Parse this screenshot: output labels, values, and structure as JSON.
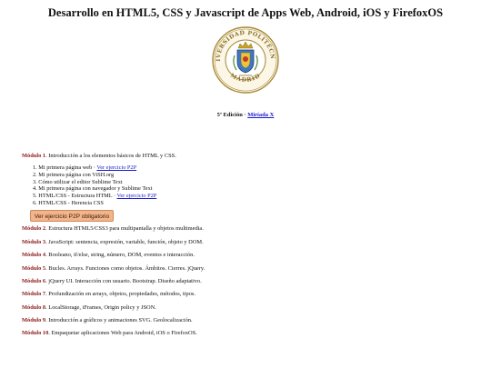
{
  "page": {
    "title": "Desarrollo en HTML5, CSS y Javascript de Apps Web, Android, iOS y FirefoxOS"
  },
  "seal": {
    "ring_text": "UNIVERSIDAD POLITÉCNICA MADRID",
    "color": "#a88b3a"
  },
  "edition": {
    "text": "5ª Edición · ",
    "link": "Miríada X"
  },
  "modules": [
    {
      "label": "Módulo 1",
      "text": ". Introducción a los elementos básicos de HTML y CSS."
    },
    {
      "label": "Módulo 2",
      "text": ". Estructura HTML5/CSS3 para multipantalla y objetos multimedia."
    },
    {
      "label": "Módulo 3",
      "text": ". JavaScript: sentencia, expresión, variable, función, objeto y DOM."
    },
    {
      "label": "Módulo 4",
      "text": ". Booleano, if/else, string, número, DOM, eventos e interacción."
    },
    {
      "label": "Módulo 5",
      "text": ". Bucles. Arrays. Funciones como objetos. Ámbitos. Cierres. jQuery."
    },
    {
      "label": "Módulo 6",
      "text": ". jQuery UI. Interacción con usuario. Bootstrap. Diseño adaptativo."
    },
    {
      "label": "Módulo 7",
      "text": ". Profundización en arrays, objetos, propiedades, métodos, tipos."
    },
    {
      "label": "Módulo 8",
      "text": ". LocalStorage, iFrames, Origin policy y JSON."
    },
    {
      "label": "Módulo 9",
      "text": ". Introducción a gráficos y animaciones SVG. Geolocalización."
    },
    {
      "label": "Módulo 10",
      "text": ". Empaquetar aplicaciones Web para Android, iOS o FirefoxOS."
    }
  ],
  "lessons": [
    {
      "text": "1. Mi primera página web · ",
      "link": "Ver ejercicio P2P"
    },
    {
      "text": "2. Mi primera página con ViSH.org",
      "link": ""
    },
    {
      "text": "3. Cómo utilizar el editor Sublime Text",
      "link": ""
    },
    {
      "text": "4. Mi primera página con navegador y Sublime Text",
      "link": ""
    },
    {
      "text": "5. HTML/CSS - Estructura HTML · ",
      "link": "Ver ejercicio P2P"
    },
    {
      "text": "6. HTML/CSS - Herencia CSS",
      "link": ""
    }
  ],
  "p2p_button": {
    "label": "Ver ejercicio P2P obligatorio",
    "color": "#f4b48a"
  }
}
